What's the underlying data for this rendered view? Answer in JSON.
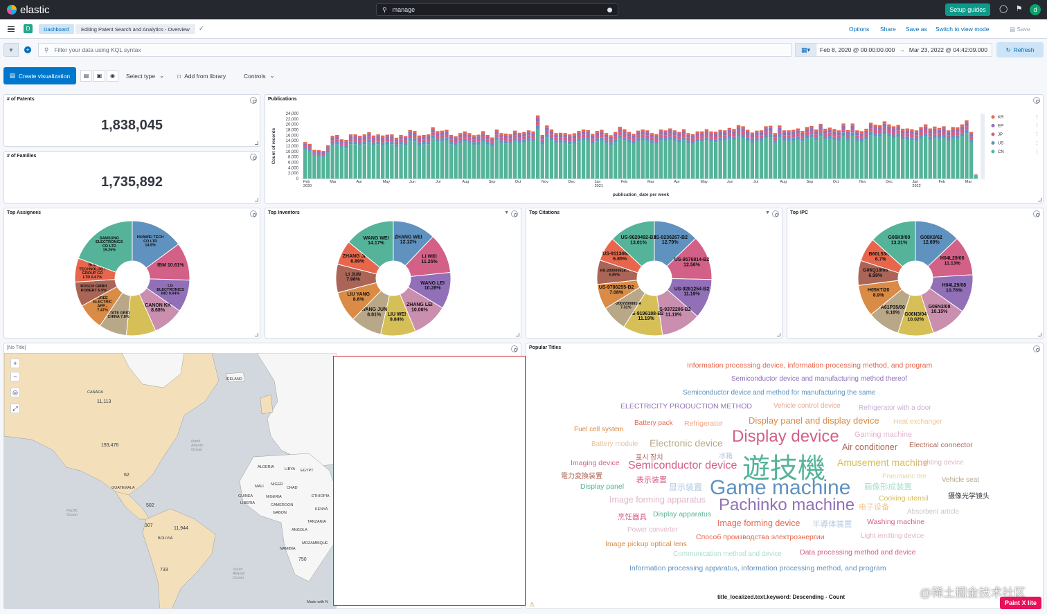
{
  "header": {
    "brand": "elastic",
    "search_value": "manage",
    "setup_label": "Setup guides",
    "avatar_letter": "d"
  },
  "breadcrumbs": {
    "space_letter": "D",
    "dashboard": "Dashboard",
    "current": "Editing Patent Search and Analytics - Overview"
  },
  "header_actions": {
    "options": "Options",
    "share": "Share",
    "save_as": "Save as",
    "switch": "Switch to view mode",
    "save": "Save"
  },
  "query": {
    "placeholder": "Filter your data using KQL syntax",
    "date_start": "Feb 8, 2020 @ 00:00:00.000",
    "date_end": "Mar 23, 2022 @ 04:42:09.000",
    "refresh": "Refresh"
  },
  "toolbar": {
    "create": "Create visualization",
    "select_type": "Select type",
    "add_library": "Add from library",
    "controls": "Controls"
  },
  "metrics": {
    "patents_title": "# of Patents",
    "patents_value": "1,838,045",
    "families_title": "# of Families",
    "families_value": "1,735,892"
  },
  "publications": {
    "title": "Publications",
    "ylabel": "Count of records",
    "xlabel": "publication_date per week",
    "yticks": [
      "24,000",
      "22,000",
      "20,000",
      "18,000",
      "16,000",
      "14,000",
      "12,000",
      "10,000",
      "8,000",
      "6,000",
      "4,000",
      "2,000",
      "0"
    ],
    "xticks": [
      {
        "label": "Feb",
        "sub": "2020"
      },
      {
        "label": "Mar",
        "sub": ""
      },
      {
        "label": "Apr",
        "sub": ""
      },
      {
        "label": "May",
        "sub": ""
      },
      {
        "label": "Jun",
        "sub": ""
      },
      {
        "label": "Jul",
        "sub": ""
      },
      {
        "label": "Aug",
        "sub": ""
      },
      {
        "label": "Sep",
        "sub": ""
      },
      {
        "label": "Oct",
        "sub": ""
      },
      {
        "label": "Nov",
        "sub": ""
      },
      {
        "label": "Dec",
        "sub": ""
      },
      {
        "label": "Jan",
        "sub": "2021"
      },
      {
        "label": "Feb",
        "sub": ""
      },
      {
        "label": "Mar",
        "sub": ""
      },
      {
        "label": "Apr",
        "sub": ""
      },
      {
        "label": "May",
        "sub": ""
      },
      {
        "label": "Jun",
        "sub": ""
      },
      {
        "label": "Jul",
        "sub": ""
      },
      {
        "label": "Aug",
        "sub": ""
      },
      {
        "label": "Sep",
        "sub": ""
      },
      {
        "label": "Oct",
        "sub": ""
      },
      {
        "label": "Nov",
        "sub": ""
      },
      {
        "label": "Dec",
        "sub": ""
      },
      {
        "label": "Jan",
        "sub": "2022"
      },
      {
        "label": "Feb",
        "sub": ""
      },
      {
        "label": "Mar",
        "sub": ""
      }
    ],
    "legend": [
      {
        "name": "KR",
        "color": "#e7664c"
      },
      {
        "name": "EP",
        "color": "#9170b8"
      },
      {
        "name": "JP",
        "color": "#d36086"
      },
      {
        "name": "US",
        "color": "#6092c0"
      },
      {
        "name": "CN",
        "color": "#54b399"
      }
    ]
  },
  "chart_data": {
    "type": "bar",
    "stacked": true,
    "ylim": [
      0,
      24000
    ],
    "series_names": [
      "CN",
      "US",
      "JP",
      "EP",
      "KR"
    ],
    "pattern_note": "weekly stacked counts",
    "totals": [
      13500,
      12800,
      10600,
      10500,
      10200,
      12300,
      15800,
      16100,
      14500,
      14300,
      16300,
      16300,
      15800,
      16300,
      17100,
      15900,
      16300,
      15900,
      16200,
      16300,
      15100,
      16100,
      15700,
      17900,
      17600,
      15900,
      16100,
      16300,
      18900,
      17500,
      17700,
      18000,
      16100,
      15600,
      16800,
      17400,
      16800,
      16000,
      16200,
      17500,
      16100,
      15200,
      18100,
      16800,
      16600,
      16400,
      17700,
      16900,
      17200,
      17800,
      17400,
      23300,
      16100,
      19600,
      18100,
      16800,
      16900,
      16800,
      16300,
      16700,
      17600,
      18100,
      17900,
      16500,
      17600,
      18000,
      16800,
      16000,
      17200,
      19100,
      18200,
      17200,
      16500,
      17700,
      18100,
      17800,
      16800,
      16400,
      18100,
      17800,
      18500,
      17800,
      17200,
      18200,
      16800,
      16400,
      17400,
      17400,
      18200,
      17400,
      17300,
      18000,
      17800,
      18700,
      18300,
      19700,
      19300,
      18000,
      17000,
      17700,
      17800,
      19300,
      19500,
      16800,
      19600,
      17800,
      17800,
      18000,
      18500,
      17600,
      19000,
      19400,
      18100,
      20200,
      18400,
      18800,
      18300,
      17800,
      20300,
      17900,
      20300,
      17800,
      17500,
      18400,
      20600,
      19900,
      19700,
      21100,
      20000,
      19300,
      19800,
      18400,
      18500,
      18200,
      17800,
      19000,
      20000,
      18500,
      19200,
      18700,
      19300,
      17800,
      19000,
      18900,
      20000,
      21500,
      17200,
      1600
    ],
    "cn_share": 0.78,
    "us_share": 0.06,
    "jp_share": 0.06,
    "ep_share": 0.06,
    "kr_share": 0.04
  },
  "pies": [
    {
      "title": "Top Assignees",
      "slices": [
        {
          "label": "HUAWEI TECH CO LTD 14.8%",
          "value": 14.8,
          "color": "#6092c0"
        },
        {
          "label": "IBM 10.61%",
          "value": 10.61,
          "color": "#d36086"
        },
        {
          "label": "LG ELECTRONICS INC 9.04%",
          "value": 9.04,
          "color": "#9170b8"
        },
        {
          "label": "CANON KK 8.68%",
          "value": 8.68,
          "color": "#ca8eae"
        },
        {
          "label": "",
          "value": 8.3,
          "color": "#d6bf57"
        },
        {
          "label": "STATE GRID CHINA 7.8%",
          "value": 7.8,
          "color": "#b9a888"
        },
        {
          "label": "GREE ELECTRIC APP... 7.47%",
          "value": 7.47,
          "color": "#da8b45"
        },
        {
          "label": "BOSCH GMBH ROBERT 6.9%",
          "value": 6.9,
          "color": "#aa6556"
        },
        {
          "label": "BOE TECHNOLOGY GROUP CO LTD 6.67%",
          "value": 6.67,
          "color": "#e7664c"
        },
        {
          "label": "SAMSUNG ELECTRONICS CO LTD 19.26%",
          "value": 19.26,
          "color": "#54b399"
        }
      ]
    },
    {
      "title": "Top Inventors",
      "slices": [
        {
          "label": "ZHANG WEI 12.12%",
          "value": 12.12,
          "color": "#6092c0"
        },
        {
          "label": "LI WEI 11.25%",
          "value": 11.25,
          "color": "#d36086"
        },
        {
          "label": "WANG LEI 10.28%",
          "value": 10.28,
          "color": "#9170b8"
        },
        {
          "label": "ZHANG LEI 10.06%",
          "value": 10.06,
          "color": "#ca8eae"
        },
        {
          "label": "LIU WEI 9.84%",
          "value": 9.84,
          "color": "#d6bf57"
        },
        {
          "label": "WANG JUN 8.81%",
          "value": 8.81,
          "color": "#b9a888"
        },
        {
          "label": "LIU YANG 8.6%",
          "value": 8.6,
          "color": "#da8b45"
        },
        {
          "label": "LI JUN 7.98%",
          "value": 7.98,
          "color": "#aa6556"
        },
        {
          "label": "ZHANG JIAN 6.89%",
          "value": 6.89,
          "color": "#e7664c"
        },
        {
          "label": "WANG WEI 14.17%",
          "value": 14.17,
          "color": "#54b399"
        }
      ]
    },
    {
      "title": "Top Citations",
      "slices": [
        {
          "label": "US-9236267-B2 12.79%",
          "value": 12.79,
          "color": "#6092c0"
        },
        {
          "label": "US-9576814-B2 12.56%",
          "value": 12.56,
          "color": "#d36086"
        },
        {
          "label": "US-9281254-B2 11.19%",
          "value": 11.19,
          "color": "#9170b8"
        },
        {
          "label": "US-9372206-B2 11.19%",
          "value": 11.19,
          "color": "#ca8eae"
        },
        {
          "label": "US-9196188-B2 11.19%",
          "value": 11.19,
          "color": "#d6bf57"
        },
        {
          "label": "JP-2007200891-A 7.31%",
          "value": 7.31,
          "color": "#b9a888"
        },
        {
          "label": "US-9786255-B2 7.08%",
          "value": 7.08,
          "color": "#da8b45"
        },
        {
          "label": "KR-200000518... 6.85%",
          "value": 6.85,
          "color": "#aa6556"
        },
        {
          "label": "US-9113468-B2 6.85%",
          "value": 6.85,
          "color": "#e7664c"
        },
        {
          "label": "US-9620492-B1 13.01%",
          "value": 13.01,
          "color": "#54b399"
        }
      ]
    },
    {
      "title": "Top IPC",
      "slices": [
        {
          "label": "G06K9/62 12.89%",
          "value": 12.89,
          "color": "#6092c0"
        },
        {
          "label": "H04L29/06 11.13%",
          "value": 11.13,
          "color": "#d36086"
        },
        {
          "label": "H04L29/08 10.76%",
          "value": 10.76,
          "color": "#9170b8"
        },
        {
          "label": "G06N3/08 10.15%",
          "value": 10.15,
          "color": "#ca8eae"
        },
        {
          "label": "G06N3/04 10.02%",
          "value": 10.02,
          "color": "#d6bf57"
        },
        {
          "label": "A61P35/00 9.16%",
          "value": 9.16,
          "color": "#b9a888"
        },
        {
          "label": "H05K7/20 8.9%",
          "value": 8.9,
          "color": "#da8b45"
        },
        {
          "label": "G06Q10/06 6.99%",
          "value": 6.99,
          "color": "#aa6556"
        },
        {
          "label": "B60L53/00 6.7%",
          "value": 6.7,
          "color": "#e7664c"
        },
        {
          "label": "G06K9/00 13.31%",
          "value": 13.31,
          "color": "#54b399"
        }
      ]
    }
  ],
  "map": {
    "title": "[No Title]",
    "labels": [
      "CANADA",
      "11,113",
      "ICELAND",
      "193,476",
      "ALGERIA",
      "LIBYA",
      "EGYPT",
      "MALI",
      "NIGER",
      "CHAD",
      "GUATEMALA",
      "GUINEA",
      "NIGERIA",
      "ETHIOPIA",
      "LIBERIA",
      "CAMEROON",
      "KENYA",
      "GABON",
      "TANZANIA",
      "ANGOLA",
      "502",
      "307",
      "11,944",
      "BOLIVIA",
      "NAMIBIA",
      "MOZAMBIQUE",
      "750",
      "733",
      "62",
      "Made with N",
      "North Atlantic Ocean",
      "Pacific Ocean",
      "South Atlantic Ocean"
    ]
  },
  "cloud": {
    "title": "Popular Titles",
    "footer": "title_localized.text.keyword: Descending - Count",
    "words": [
      {
        "t": "Information processing device, information processing method, and program",
        "c": "#e7664c",
        "s": 10.5
      },
      {
        "t": "Semiconductor device and manufacturing method thereof",
        "c": "#9170b8",
        "s": 10
      },
      {
        "t": "Semiconductor device and method for manufacturing the same",
        "c": "#6092c0",
        "s": 10
      },
      {
        "t": "ELECTRICITY PRODUCTION METHOD",
        "c": "#9170b8",
        "s": 10.5
      },
      {
        "t": "Vehicle control device",
        "c": "#e7a890",
        "s": 10
      },
      {
        "t": "Refrigerator with a door",
        "c": "#c8b0d6",
        "s": 10
      },
      {
        "t": "Battery pack",
        "c": "#e7664c",
        "s": 10
      },
      {
        "t": "Refrigerator",
        "c": "#f0a58a",
        "s": 10.5
      },
      {
        "t": "Display panel and display device",
        "c": "#da8b45",
        "s": 13
      },
      {
        "t": "Heat exchanger",
        "c": "#f0c890",
        "s": 10
      },
      {
        "t": "Fuel cell system",
        "c": "#da8b45",
        "s": 10
      },
      {
        "t": "Display device",
        "c": "#d36086",
        "s": 24
      },
      {
        "t": "Gaming machine",
        "c": "#e0b6cc",
        "s": 11
      },
      {
        "t": "Battery module",
        "c": "#e8c0a0",
        "s": 10
      },
      {
        "t": "Electronic device",
        "c": "#b9a888",
        "s": 14
      },
      {
        "t": "Air conditioner",
        "c": "#aa6556",
        "s": 12.5
      },
      {
        "t": "Electrical connector",
        "c": "#aa6556",
        "s": 10.5
      },
      {
        "t": "표시 장치",
        "c": "#aa6556",
        "s": 10
      },
      {
        "t": "冰箱",
        "c": "#b0c8e0",
        "s": 10
      },
      {
        "t": "遊技機",
        "c": "#54b399",
        "s": 40
      },
      {
        "t": "Imaging device",
        "c": "#d36086",
        "s": 10.5
      },
      {
        "t": "Amusement machine",
        "c": "#d6bf57",
        "s": 14
      },
      {
        "t": "Lighting device",
        "c": "#e0b6cc",
        "s": 10
      },
      {
        "t": "電力変換装置",
        "c": "#aa6556",
        "s": 10
      },
      {
        "t": "Semiconductor device",
        "c": "#d36086",
        "s": 16
      },
      {
        "t": "表示装置",
        "c": "#d36086",
        "s": 11
      },
      {
        "t": "Pneumatic tire",
        "c": "#e0d6a8",
        "s": 10
      },
      {
        "t": "Vehicle seat",
        "c": "#b9a888",
        "s": 10
      },
      {
        "t": "Display panel",
        "c": "#54b399",
        "s": 10.5
      },
      {
        "t": "显示装置",
        "c": "#b0c8e0",
        "s": 12
      },
      {
        "t": "Game machine",
        "c": "#6092c0",
        "s": 30
      },
      {
        "t": "画像形成装置",
        "c": "#a8e0cc",
        "s": 11.5
      },
      {
        "t": "摄像光学镜头",
        "c": "#343741",
        "s": 10
      },
      {
        "t": "Image forming apparatus",
        "c": "#e0b6cc",
        "s": 12.5
      },
      {
        "t": "Cooking utensil",
        "c": "#d6bf57",
        "s": 10.5
      },
      {
        "t": "电子设备",
        "c": "#f0c890",
        "s": 11
      },
      {
        "t": "Absorbent article",
        "c": "#c8c8c8",
        "s": 10
      },
      {
        "t": "烹饪器具",
        "c": "#d36086",
        "s": 10.5
      },
      {
        "t": "Display apparatus",
        "c": "#54b399",
        "s": 10.5
      },
      {
        "t": "Pachinko machine",
        "c": "#9170b8",
        "s": 24
      },
      {
        "t": "Image forming device",
        "c": "#e7664c",
        "s": 12.5
      },
      {
        "t": "半導体装置",
        "c": "#b0c8e0",
        "s": 11.5
      },
      {
        "t": "Washing machine",
        "c": "#d36086",
        "s": 10.5
      },
      {
        "t": "Power converter",
        "c": "#e0b6cc",
        "s": 10
      },
      {
        "t": "Способ производства электроэнергии",
        "c": "#e7664c",
        "s": 10.5
      },
      {
        "t": "Light emitting device",
        "c": "#e0b6cc",
        "s": 10
      },
      {
        "t": "Image pickup optical lens",
        "c": "#da8b45",
        "s": 10.5
      },
      {
        "t": "Communication method and device",
        "c": "#a8e0cc",
        "s": 10
      },
      {
        "t": "Data processing method and device",
        "c": "#d36086",
        "s": 10.5
      },
      {
        "t": "Information processing apparatus, information processing method, and program",
        "c": "#6092c0",
        "s": 10.5
      }
    ]
  },
  "overlay": {
    "watermark": "@稀土掘金技术社区",
    "paint_badge": "Paint X lite"
  }
}
